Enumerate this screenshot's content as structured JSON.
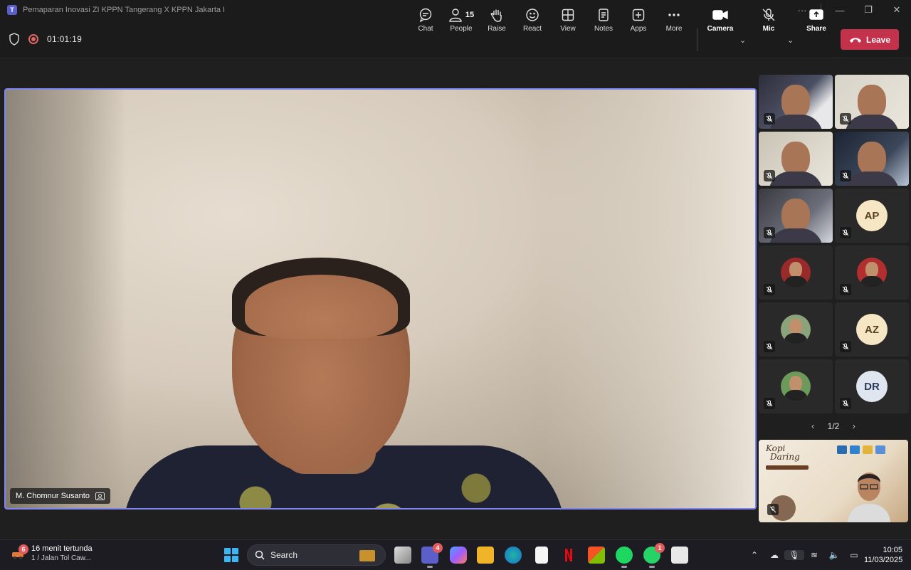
{
  "window": {
    "title": "Pemaparan Inovasi ZI KPPN Tangerang X KPPN Jakarta I",
    "app_icon": "teams-icon",
    "controls": [
      "more-icon",
      "minimize-icon",
      "restore-icon",
      "close-icon"
    ]
  },
  "toolbar": {
    "timer": "01:01:19",
    "chat_label": "Chat",
    "people_label": "People",
    "people_count": "15",
    "raise_label": "Raise",
    "react_label": "React",
    "view_label": "View",
    "notes_label": "Notes",
    "apps_label": "Apps",
    "more_label": "More",
    "camera_label": "Camera",
    "mic_label": "Mic",
    "share_label": "Share",
    "leave_label": "Leave"
  },
  "stage": {
    "speaker_name": "M. Chomnur Susanto"
  },
  "gallery": {
    "tiles": [
      {
        "kind": "video",
        "muted": true
      },
      {
        "kind": "video",
        "muted": true
      },
      {
        "kind": "video",
        "muted": true
      },
      {
        "kind": "video",
        "muted": true
      },
      {
        "kind": "video",
        "muted": true
      },
      {
        "kind": "initials",
        "initials": "AP",
        "muted": true
      },
      {
        "kind": "photo",
        "muted": true
      },
      {
        "kind": "photo",
        "muted": true
      },
      {
        "kind": "photo",
        "muted": true
      },
      {
        "kind": "initials",
        "initials": "AZ",
        "muted": true
      },
      {
        "kind": "photo",
        "muted": true
      },
      {
        "kind": "initials",
        "initials": "DR",
        "muted": true
      }
    ],
    "page": "1/2"
  },
  "screen_share_tile": {
    "logo_text_line1": "Kopi",
    "logo_text_line2": "Daring"
  },
  "taskbar": {
    "weather_badge": "6",
    "weather_line1": "16 menit tertunda",
    "weather_line2": "1 / Jalan Tol Caw...",
    "search_placeholder": "Search",
    "teams_badge": "4",
    "whatsapp_badge": "1",
    "time": "10:05",
    "date": "11/03/2025"
  },
  "colors": {
    "accent": "#7f85f5",
    "leave": "#c4314b",
    "taskbar": "#1c1c22"
  }
}
